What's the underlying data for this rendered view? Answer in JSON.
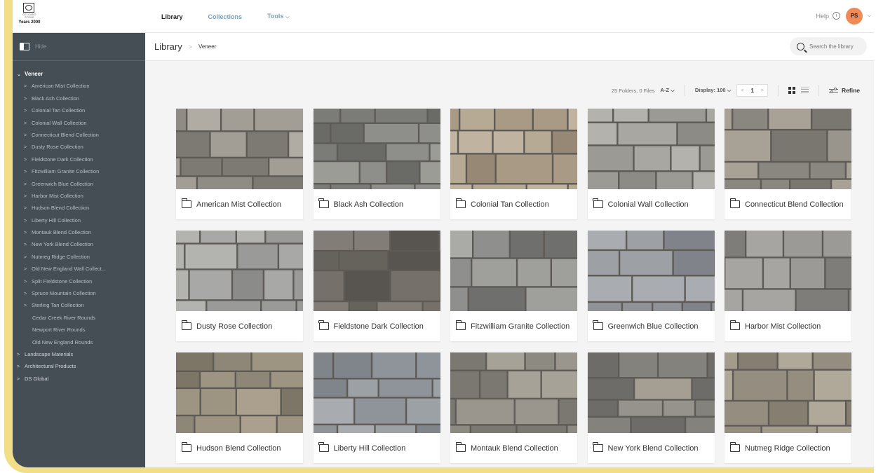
{
  "brand": {
    "logo_text": "DELGADO STONE",
    "years_text": "Years 2000"
  },
  "nav": {
    "library": "Library",
    "collections": "Collections",
    "tools": "Tools",
    "help": "Help",
    "help_icon": "i",
    "avatar_initials": "PS"
  },
  "sidebar": {
    "hide_label": "Hide",
    "tree": [
      {
        "label": "Veneer",
        "level": 0,
        "open": true,
        "caret": "⌄"
      },
      {
        "label": "American Mist Collection",
        "level": 1,
        "caret": ">"
      },
      {
        "label": "Black Ash Collection",
        "level": 1,
        "caret": ">"
      },
      {
        "label": "Colonial Tan Collection",
        "level": 1,
        "caret": ">"
      },
      {
        "label": "Colonial Wall Collection",
        "level": 1,
        "caret": ">"
      },
      {
        "label": "Connecticut Blend Collection",
        "level": 1,
        "caret": ">"
      },
      {
        "label": "Dusty Rose Collection",
        "level": 1,
        "caret": ">"
      },
      {
        "label": "Fieldstone Dark Collection",
        "level": 1,
        "caret": ">"
      },
      {
        "label": "Fitzwilliam Granite Collection",
        "level": 1,
        "caret": ">"
      },
      {
        "label": "Greenwich Blue Collection",
        "level": 1,
        "caret": ">"
      },
      {
        "label": "Harbor Mist Collection",
        "level": 1,
        "caret": ">"
      },
      {
        "label": "Hudson Blend Collection",
        "level": 1,
        "caret": ">"
      },
      {
        "label": "Liberty Hill Collection",
        "level": 1,
        "caret": ">"
      },
      {
        "label": "Montauk Blend Collection",
        "level": 1,
        "caret": ">"
      },
      {
        "label": "New York Blend Collection",
        "level": 1,
        "caret": ">"
      },
      {
        "label": "Nutmeg Ridge Collection",
        "level": 1,
        "caret": ">"
      },
      {
        "label": "Old New England Wall Collect...",
        "level": 1,
        "caret": ">"
      },
      {
        "label": "Split Fieldstone Collection",
        "level": 1,
        "caret": ">"
      },
      {
        "label": "Spruce Mountain Collection",
        "level": 1,
        "caret": ">"
      },
      {
        "label": "Sterling Tan Collection",
        "level": 1,
        "caret": ">"
      },
      {
        "label": "Cedar Creek River Rounds",
        "level": 1,
        "leaf": true
      },
      {
        "label": "Newport River Rounds",
        "level": 1,
        "leaf": true
      },
      {
        "label": "Old New England Rounds",
        "level": 1,
        "leaf": true
      },
      {
        "label": "Landscape Materials",
        "level": 0,
        "caret": ">"
      },
      {
        "label": "Architectural Products",
        "level": 0,
        "caret": ">"
      },
      {
        "label": "DS Global",
        "level": 0,
        "caret": ">"
      }
    ]
  },
  "breadcrumb": {
    "root": "Library",
    "separator": ">",
    "current": "Veneer"
  },
  "search": {
    "placeholder": "Search the library"
  },
  "toolbar": {
    "count": "25 Folders, 0 Files",
    "sort": "A-Z",
    "display": "Display: 100",
    "page": "1",
    "prev": "<",
    "next": ">",
    "refine": "Refine"
  },
  "cards": [
    {
      "label": "American Mist Collection",
      "colors": [
        "#8f8c86",
        "#a29e96",
        "#7d7a74",
        "#b0aca3"
      ]
    },
    {
      "label": "Black Ash Collection",
      "colors": [
        "#7b7c78",
        "#8e8f8a",
        "#6a6b67",
        "#9b9c96"
      ]
    },
    {
      "label": "Colonial Tan Collection",
      "colors": [
        "#a89a85",
        "#b7aa95",
        "#968874",
        "#c0b4a0"
      ]
    },
    {
      "label": "Colonial Wall Collection",
      "colors": [
        "#9c9a95",
        "#a9a7a2",
        "#8d8b86",
        "#b4b2ac"
      ]
    },
    {
      "label": "Connecticut Blend Collection",
      "colors": [
        "#8a8781",
        "#9a958c",
        "#7a7771",
        "#a8a196"
      ]
    },
    {
      "label": "Dusty Rose Collection",
      "colors": [
        "#9a9a98",
        "#a8a8a6",
        "#8b8b89",
        "#b3b3b0"
      ]
    },
    {
      "label": "Fieldstone Dark Collection",
      "colors": [
        "#66625c",
        "#75706a",
        "#58544f",
        "#827d76"
      ]
    },
    {
      "label": "Fitzwilliam Granite Collection",
      "colors": [
        "#8f8f8d",
        "#9f9f9c",
        "#6f706e",
        "#aaaaa7"
      ]
    },
    {
      "label": "Greenwich Blue Collection",
      "colors": [
        "#8f9397",
        "#9da1a5",
        "#80848a",
        "#a9acb0"
      ]
    },
    {
      "label": "Harbor Mist Collection",
      "colors": [
        "#8c8b88",
        "#9b9a97",
        "#7e7d7a",
        "#a6a5a2"
      ]
    },
    {
      "label": "Hudson Blend Collection",
      "colors": [
        "#8e8676",
        "#9d9482",
        "#7d7667",
        "#aaa08d"
      ]
    },
    {
      "label": "Liberty Hill Collection",
      "colors": [
        "#8f949a",
        "#9ca1a6",
        "#80858b",
        "#a8acb1"
      ]
    },
    {
      "label": "Montauk Blend Collection",
      "colors": [
        "#8d8a82",
        "#9a968d",
        "#7b7871",
        "#a7a298"
      ]
    },
    {
      "label": "New York Blend Collection",
      "colors": [
        "#84827d",
        "#96938d",
        "#6e6c68",
        "#a59f93"
      ]
    },
    {
      "label": "Nutmeg Ridge Collection",
      "colors": [
        "#958d7f",
        "#a39b8c",
        "#857e71",
        "#b0a898"
      ]
    }
  ]
}
